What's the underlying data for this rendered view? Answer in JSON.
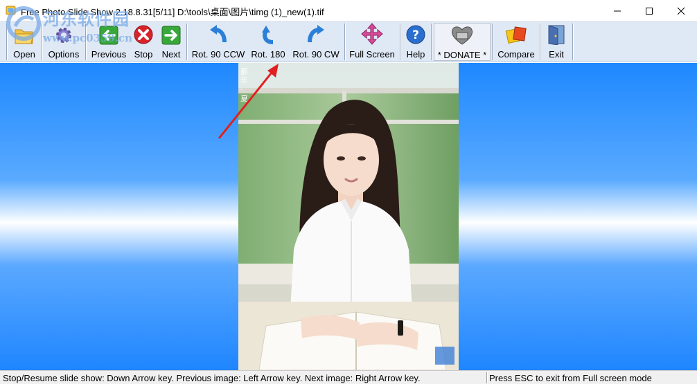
{
  "window": {
    "title": "Free Photo Slide Show 2.18.8.31[5/11] D:\\tools\\桌面\\图片\\timg (1)_new(1).tif"
  },
  "watermark": {
    "line1": "河东软件园",
    "line2": "www.pc0359.cn"
  },
  "toolbar": {
    "open": "Open",
    "options": "Options",
    "previous": "Previous",
    "stop": "Stop",
    "next": "Next",
    "rot_ccw": "Rot. 90 CCW",
    "rot_180": "Rot. 180",
    "rot_cw": "Rot. 90 CW",
    "full_screen": "Full Screen",
    "help": "Help",
    "donate": "* DONATE *",
    "compare": "Compare",
    "exit": "Exit"
  },
  "photo": {
    "caption_vertical": "那年 · 夏"
  },
  "status": {
    "left": "Stop/Resume slide show: Down Arrow key. Previous image: Left Arrow key. Next image: Right Arrow key.",
    "right": "Press ESC to exit from Full screen mode"
  },
  "colors": {
    "toolbar_bg": "#dfe8f5",
    "content_blue": "#1e88ff",
    "arrow_red": "#e02020"
  }
}
